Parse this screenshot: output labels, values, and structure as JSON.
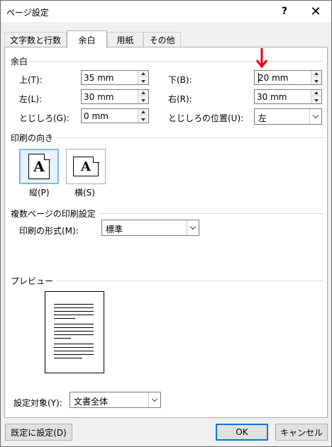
{
  "window": {
    "title": "ページ設定",
    "help_label": "?",
    "close_label": "✕"
  },
  "tabs": [
    {
      "label": "文字数と行数",
      "active": false
    },
    {
      "label": "余白",
      "active": true
    },
    {
      "label": "用紙",
      "active": false
    },
    {
      "label": "その他",
      "active": false
    }
  ],
  "margins": {
    "group_label": "余白",
    "top_label": "上(T):",
    "top_value": "35 mm",
    "bottom_label": "下(B):",
    "bottom_value": "20 mm",
    "left_label": "左(L):",
    "left_value": "30 mm",
    "right_label": "右(R):",
    "right_value": "30 mm",
    "gutter_label": "とじしろ(G):",
    "gutter_value": "0 mm",
    "gutter_pos_label": "とじしろの位置(U):",
    "gutter_pos_value": "左"
  },
  "orientation": {
    "group_label": "印刷の向き",
    "portrait_label": "縦(P)",
    "landscape_label": "横(S)",
    "icon_letter": "A",
    "selected": "portrait"
  },
  "pages": {
    "group_label": "複数ページの印刷設定",
    "format_label": "印刷の形式(M):",
    "format_value": "標準"
  },
  "preview": {
    "group_label": "プレビュー"
  },
  "apply": {
    "label": "設定対象(Y):",
    "value": "文書全体"
  },
  "buttons": {
    "set_default": "既定に設定(D)",
    "ok": "OK",
    "cancel": "キャンセル"
  },
  "colors": {
    "annotation_arrow": "#e60012",
    "default_button_border": "#0078d7",
    "selected_orientation_bg": "#e5f1fb"
  }
}
